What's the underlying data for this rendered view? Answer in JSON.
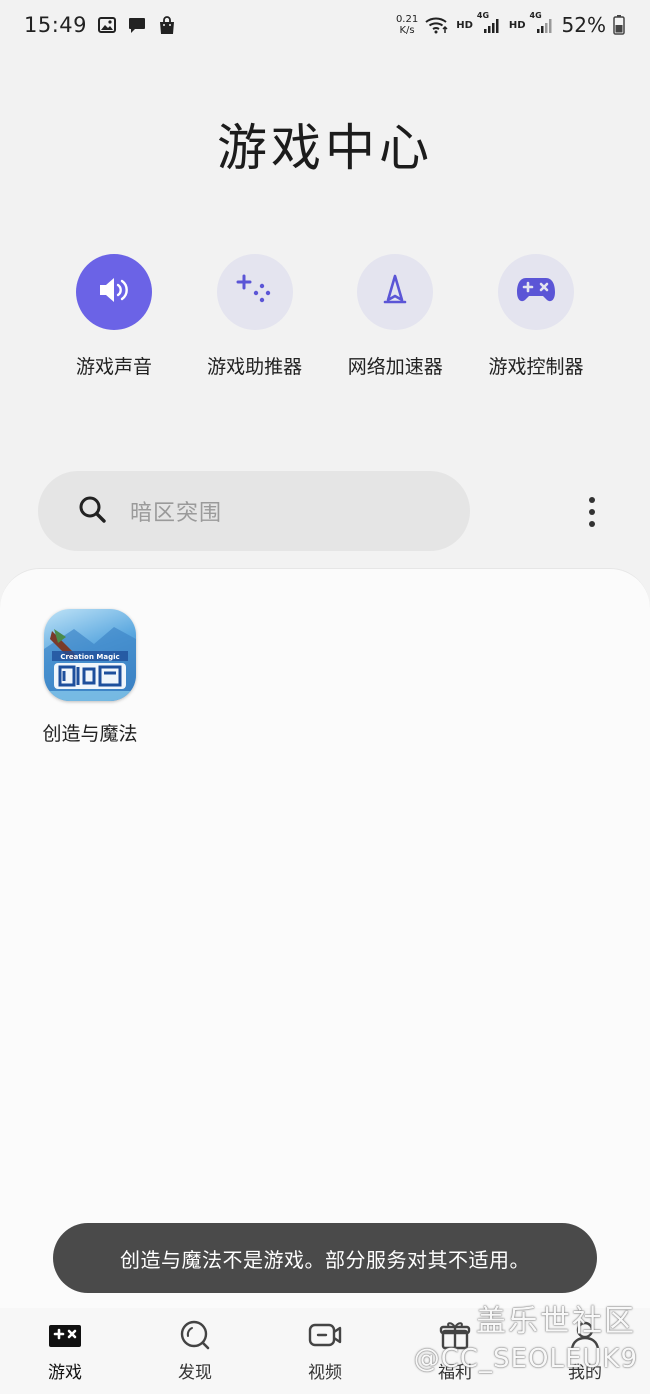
{
  "status_bar": {
    "time": "15:49",
    "net_speed_value": "0.21",
    "net_speed_unit": "K/s",
    "hd1": "HD",
    "signal1_type": "4G",
    "hd2": "HD",
    "signal2_type": "4G",
    "battery": "52%",
    "icons": [
      "gallery-icon",
      "message-icon",
      "shopping-bag-icon",
      "wifi-icon",
      "signal-icon",
      "battery-icon"
    ]
  },
  "header": {
    "title": "游戏中心"
  },
  "quick_actions": [
    {
      "label": "游戏声音",
      "icon": "speaker-icon",
      "active": true
    },
    {
      "label": "游戏助推器",
      "icon": "game-booster-icon",
      "active": false
    },
    {
      "label": "网络加速器",
      "icon": "rocket-icon",
      "active": false
    },
    {
      "label": "游戏控制器",
      "icon": "gamepad-icon",
      "active": false
    }
  ],
  "search": {
    "placeholder": "暗区突围"
  },
  "games": [
    {
      "name": "创造与魔法"
    }
  ],
  "toast": {
    "message": "创造与魔法不是游戏。部分服务对其不适用。"
  },
  "bottom_nav": [
    {
      "label": "游戏",
      "icon": "gamepad-icon",
      "active": true
    },
    {
      "label": "发现",
      "icon": "discover-icon",
      "active": false
    },
    {
      "label": "视频",
      "icon": "video-icon",
      "active": false
    },
    {
      "label": "福利",
      "icon": "gift-icon",
      "active": false
    },
    {
      "label": "我的",
      "icon": "profile-icon",
      "active": false
    }
  ],
  "watermark": {
    "line1": "盖乐世社区",
    "line2": "@CC_SEOLEUK9"
  },
  "colors": {
    "accent": "#6b63e6",
    "icon_purple": "#5b55d6",
    "background": "#f2f2f2",
    "panel": "#fbfbfb",
    "toast": "#4a4a4a"
  }
}
